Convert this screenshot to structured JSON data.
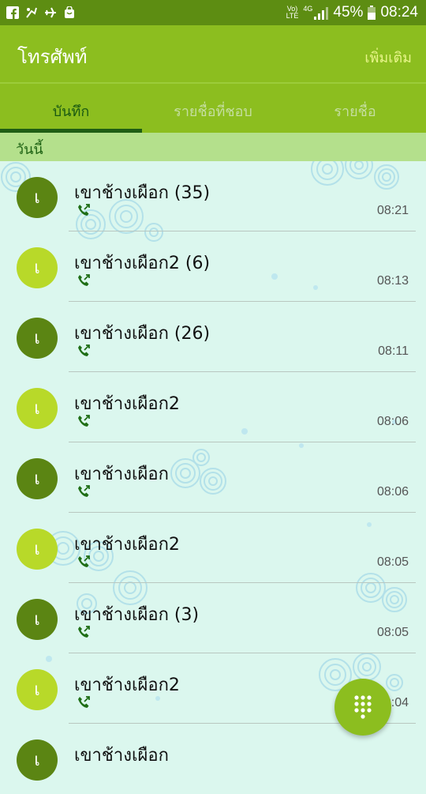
{
  "status_bar": {
    "network_label_top": "Vo)",
    "network_label_bottom": "LTE",
    "signal_type": "4G",
    "battery_percent": "45%",
    "time": "08:24",
    "icons": [
      "facebook-icon",
      "app-icon",
      "airplane-icon",
      "bag-icon",
      "signal-icon",
      "battery-icon"
    ]
  },
  "app_bar": {
    "title": "โทรศัพท์",
    "more_label": "เพิ่มเติม"
  },
  "tabs": [
    {
      "label": "บันทึก",
      "active": true
    },
    {
      "label": "รายชื่อที่ชอบ",
      "active": false
    },
    {
      "label": "รายชื่อ",
      "active": false
    }
  ],
  "section": {
    "header": "วันนี้"
  },
  "calls": [
    {
      "initial": "เ",
      "name": "เขาช้างเผือก (35)",
      "time": "08:21",
      "avatar_style": "dark"
    },
    {
      "initial": "เ",
      "name": "เขาช้างเผือก2 (6)",
      "time": "08:13",
      "avatar_style": "light"
    },
    {
      "initial": "เ",
      "name": "เขาช้างเผือก (26)",
      "time": "08:11",
      "avatar_style": "dark"
    },
    {
      "initial": "เ",
      "name": "เขาช้างเผือก2",
      "time": "08:06",
      "avatar_style": "light"
    },
    {
      "initial": "เ",
      "name": "เขาช้างเผือก",
      "time": "08:06",
      "avatar_style": "dark"
    },
    {
      "initial": "เ",
      "name": "เขาช้างเผือก2",
      "time": "08:05",
      "avatar_style": "light"
    },
    {
      "initial": "เ",
      "name": "เขาช้างเผือก (3)",
      "time": "08:05",
      "avatar_style": "dark"
    },
    {
      "initial": "เ",
      "name": "เขาช้างเผือก2",
      "time": "08:04",
      "avatar_style": "light"
    },
    {
      "initial": "เ",
      "name": "เขาช้างเผือก",
      "time": "",
      "avatar_style": "dark"
    }
  ],
  "colors": {
    "status_bar": "#5d8d12",
    "app_bar": "#8cbe1f",
    "section_header": "#b4e08c",
    "background": "#dbf7ee",
    "avatar_dark": "#5b8513",
    "avatar_light": "#b8d929",
    "call_icon": "#1f6e16"
  },
  "fab": {
    "icon": "dialpad-icon"
  }
}
